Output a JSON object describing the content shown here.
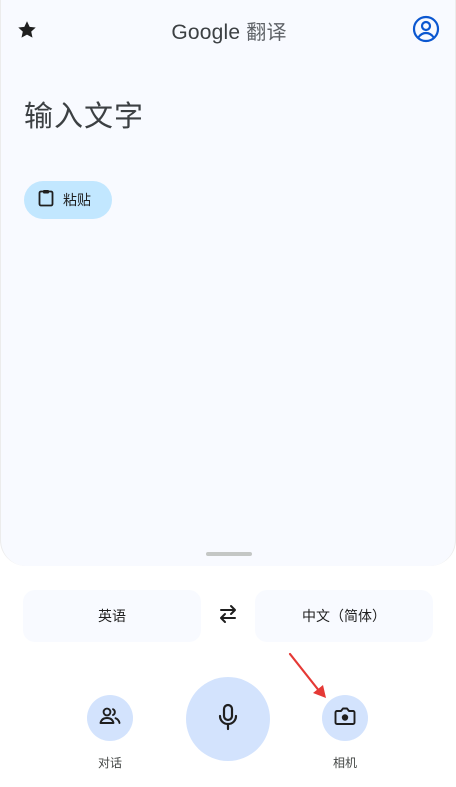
{
  "header": {
    "brand": "Google",
    "app_suffix": "翻译"
  },
  "icons": {
    "star": "star-icon",
    "account": "account-circle-icon",
    "paste": "clipboard-icon",
    "swap": "swap-arrows-icon",
    "conversation": "people-icon",
    "mic": "microphone-icon",
    "camera": "camera-icon"
  },
  "input": {
    "placeholder": "输入文字",
    "paste_label": "粘贴"
  },
  "languages": {
    "source": "英语",
    "target": "中文（简体）"
  },
  "bottom_actions": {
    "conversation_label": "对话",
    "camera_label": "相机"
  },
  "colors": {
    "panel_bg": "#f8faff",
    "chip_bg": "#c2e7ff",
    "action_bg": "#d3e3fd",
    "account_blue": "#0b57d0",
    "annotation_arrow": "#e53935"
  }
}
